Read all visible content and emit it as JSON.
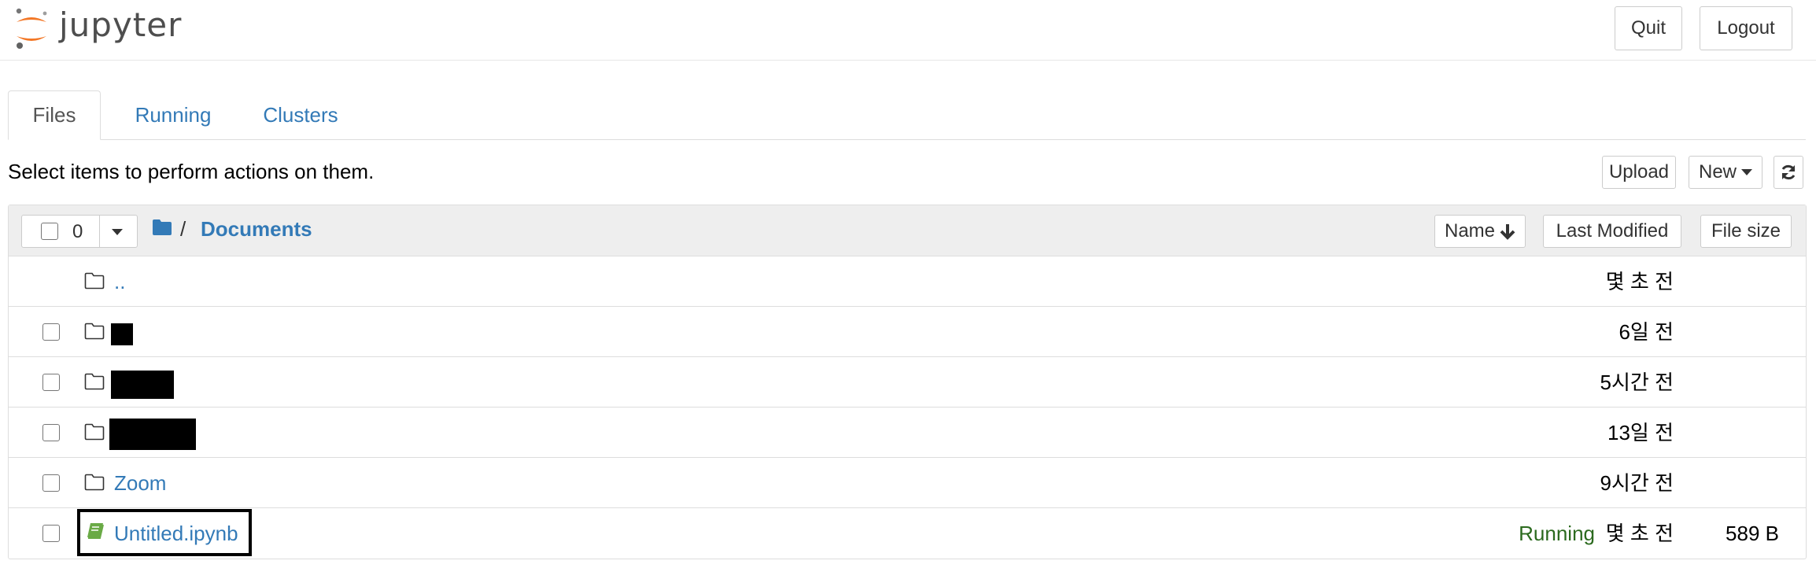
{
  "header": {
    "logo_text": "jupyter",
    "quit_label": "Quit",
    "logout_label": "Logout"
  },
  "tabs": [
    {
      "label": "Files",
      "active": true
    },
    {
      "label": "Running",
      "active": false
    },
    {
      "label": "Clusters",
      "active": false
    }
  ],
  "toolbar": {
    "select_message": "Select items to perform actions on them.",
    "upload_label": "Upload",
    "new_label": "New"
  },
  "list_header": {
    "selected_count": "0",
    "breadcrumb_separator": "/",
    "breadcrumb_current": "Documents",
    "sort_name_label": "Name",
    "sort_modified_label": "Last Modified",
    "sort_size_label": "File size"
  },
  "rows": [
    {
      "name": "..",
      "type": "folder",
      "modified": "몇 초 전",
      "size": "",
      "status": "",
      "redacted": false
    },
    {
      "name": "",
      "type": "folder",
      "modified": "6일 전",
      "size": "",
      "status": "",
      "redacted": true
    },
    {
      "name": "",
      "type": "folder",
      "modified": "5시간 전",
      "size": "",
      "status": "",
      "redacted": true
    },
    {
      "name": "",
      "type": "folder",
      "modified": "13일 전",
      "size": "",
      "status": "",
      "redacted": true
    },
    {
      "name": "Zoom",
      "type": "folder",
      "modified": "9시간 전",
      "size": "",
      "status": "",
      "redacted": false
    },
    {
      "name": "Untitled.ipynb",
      "type": "notebook",
      "modified": "몇 초 전",
      "size": "589 B",
      "status": "Running",
      "redacted": false
    }
  ],
  "icons": {
    "folder": "folder-icon",
    "notebook": "notebook-icon",
    "refresh": "refresh-icon",
    "sort_arrow": "arrow-down-icon"
  },
  "colors": {
    "link": "#337ab7",
    "running": "#2b6a1e",
    "logo_orange": "#f37726",
    "notebook_green": "#6aaa46"
  }
}
